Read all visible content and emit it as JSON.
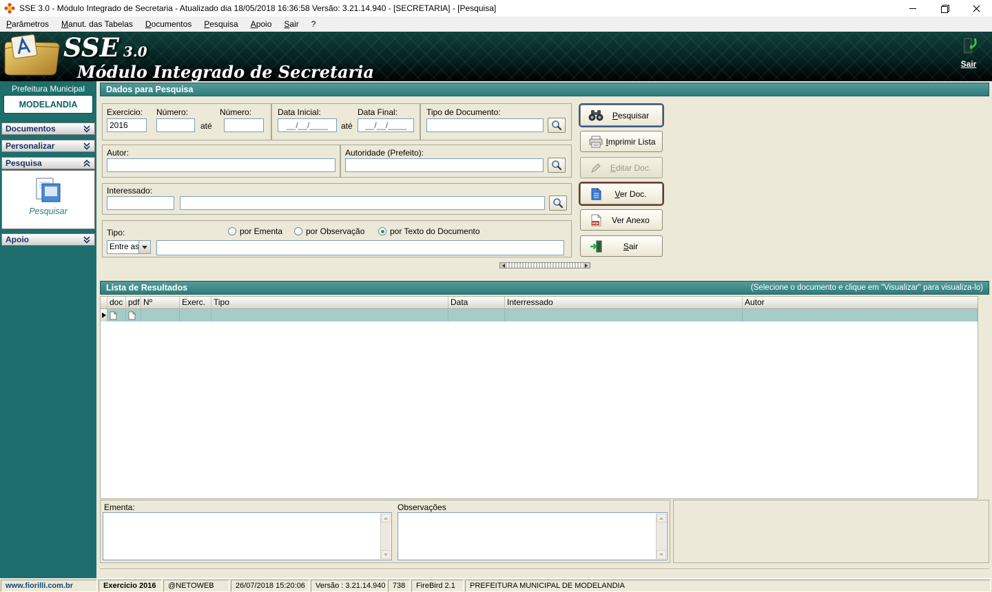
{
  "window": {
    "title": "SSE 3.0 - Módulo Integrado de Secretaria - Atualizado dia 18/05/2018 16:36:58 Versão: 3.21.14.940 - [SECRETARIA] - [Pesquisa]"
  },
  "menu": {
    "items": [
      {
        "label": "Parâmetros",
        "accel": 0
      },
      {
        "label": "Manut. das Tabelas",
        "accel": 0
      },
      {
        "label": "Documentos",
        "accel": 0
      },
      {
        "label": "Pesquisa",
        "accel": 0
      },
      {
        "label": "Apoio",
        "accel": 0
      },
      {
        "label": "Sair",
        "accel": 0
      },
      {
        "label": "?"
      }
    ]
  },
  "banner": {
    "app_name": "SSE",
    "app_version": "3.0",
    "subtitle": "Módulo Integrado de Secretaria",
    "exit_label": "Sair"
  },
  "sidebar": {
    "org_label": "Prefeitura Municipal",
    "org_name": "MODELANDIA",
    "sections": [
      {
        "label": "Documentos",
        "state": "collapsed"
      },
      {
        "label": "Personalizar",
        "state": "collapsed"
      },
      {
        "label": "Pesquisa",
        "state": "expanded"
      },
      {
        "label": "Apoio",
        "state": "collapsed"
      }
    ],
    "pesquisar_label": "Pesquisar"
  },
  "search_form": {
    "header": "Dados para Pesquisa",
    "exercicio": {
      "label": "Exercicio:",
      "value": "2016"
    },
    "numero": {
      "label": "Número:",
      "from": "",
      "to": ""
    },
    "ate_label": "até",
    "data_inicial": {
      "label": "Data Inicial:",
      "value": "__/__/____"
    },
    "data_final": {
      "label": "Data Final:",
      "value": "__/__/____"
    },
    "tipo_documento": {
      "label": "Tipo de Documento:",
      "value": ""
    },
    "autor": {
      "label": "Autor:",
      "value": ""
    },
    "autoridade": {
      "label": "Autoridade (Prefeito):",
      "value": ""
    },
    "interessado": {
      "label": "Interessado:",
      "code": "",
      "name": ""
    },
    "tipo": {
      "label": "Tipo:",
      "value": "Entre as"
    },
    "radios": [
      {
        "label": "por Ementa",
        "checked": false
      },
      {
        "label": "por Observação",
        "checked": false
      },
      {
        "label": "por Texto do Documento",
        "checked": true
      }
    ],
    "texto_documento": ""
  },
  "actions": [
    {
      "label": "Pesquisar",
      "accel": 0,
      "icon": "binoculars-icon",
      "state": "focused"
    },
    {
      "label": "Imprimir Lista",
      "accel": 0,
      "icon": "printer-icon",
      "state": "normal"
    },
    {
      "label": "Editar Doc.",
      "accel": 0,
      "icon": "pencil-icon",
      "state": "disabled"
    },
    {
      "label": "Ver Doc.",
      "accel": 0,
      "icon": "blue-document-icon",
      "state": "highlighted"
    },
    {
      "label": "Ver Anexo",
      "icon": "pdf-icon",
      "state": "normal"
    },
    {
      "label": "Sair",
      "accel": 0,
      "icon": "exit-door-icon",
      "state": "normal"
    }
  ],
  "results": {
    "header": "Lista de Resultados",
    "hint": "(Selecione o documento e clique em \"Visualizar\" para visualiza-lo)",
    "columns": [
      "doc",
      "pdf",
      "Nº",
      "Exerc.",
      "Tipo",
      "Data",
      "Interressado",
      "Autor"
    ],
    "rows": [
      {
        "doc": "",
        "pdf": "",
        "numero": "",
        "exercicio": "",
        "tipo": "",
        "data": "",
        "interessado": "",
        "autor": "",
        "selected": true
      }
    ]
  },
  "details": {
    "ementa_label": "Ementa:",
    "ementa_value": "",
    "observacoes_label": "Observações",
    "observacoes_value": ""
  },
  "statusbar": {
    "segments": [
      "www.fiorilli.com.br",
      "Exercicio 2016",
      "@NETOWEB",
      "26/07/2018 15:20:06",
      "Versão : 3.21.14.940",
      "738",
      "FireBird 2.1",
      "PREFEITURA MUNICIPAL DE MODELANDIA"
    ]
  },
  "theme": {
    "sidebar_teal": "#1d6e6d",
    "header_teal": "#2e7d7c",
    "selected_row_teal": "#a5cdc8",
    "window_beige": "#ece9d8",
    "banner_dark": "#06221f",
    "focus_ring_navy": "#3a5a8c",
    "highlight_ring_maroon": "#6b3a2a"
  },
  "icons": {
    "app-icon": "flower-glyph",
    "minimize-icon": "horizontal-bar",
    "restore-icon": "overlapping-squares",
    "close-icon": "x-cross",
    "magnifier-icon": "magnifying-glass",
    "binoculars-icon": "binoculars",
    "printer-icon": "printer",
    "pencil-icon": "pencil",
    "blue-document-icon": "blue-page",
    "pdf-icon": "pdf-page",
    "exit-door-icon": "door-with-green-arrow",
    "chevron-double-down-icon": "double-chevron-down",
    "chevron-double-up-icon": "double-chevron-up",
    "row-indicator-icon": "black-right-triangle",
    "page-icon": "white-page"
  }
}
